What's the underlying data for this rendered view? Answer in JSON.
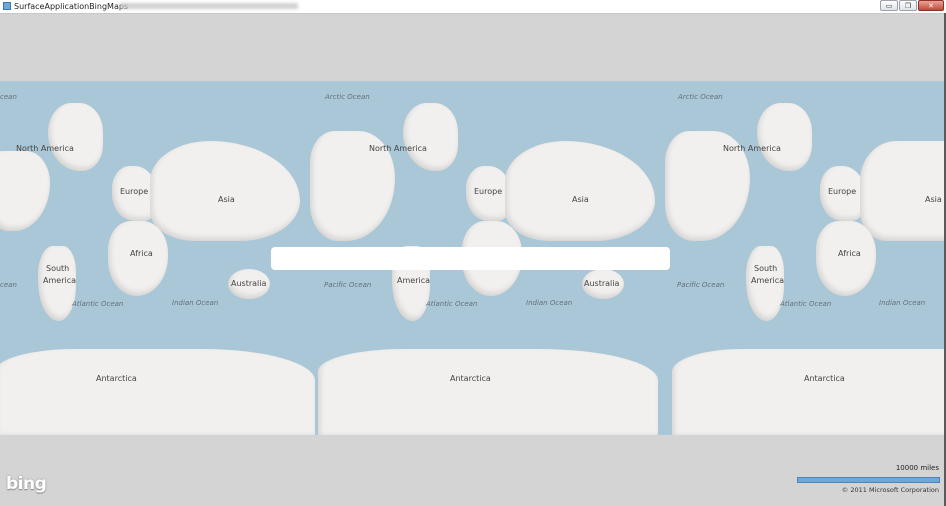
{
  "window": {
    "title": "SurfaceApplicationBingMaps",
    "controls": {
      "minimize": "▭",
      "maximize": "❐",
      "close": "✕"
    }
  },
  "map": {
    "continent_labels": [
      "North America",
      "Europe",
      "Asia",
      "Africa",
      "South America",
      "Australia",
      "Antarctica"
    ],
    "ocean_labels": [
      "Arctic Ocean",
      "Pacific Ocean",
      "Atlantic Ocean",
      "Indian Ocean"
    ],
    "edge_fragment": "cean",
    "labels_text": {
      "north_america": "North America",
      "europe": "Europe",
      "asia": "Asia",
      "africa": "Africa",
      "south": "South",
      "america": "America",
      "australia": "Australia",
      "antarctica": "Antarctica",
      "arctic_ocean": "Arctic Ocean",
      "pacific_ocean": "Pacific Ocean",
      "atlantic_ocean": "Atlantic Ocean",
      "indian_ocean": "Indian Ocean",
      "ocean_fragment": "cean"
    },
    "colors": {
      "water": "#aac7d7",
      "land": "#f1f0ee",
      "chrome": "#d4d4d4"
    }
  },
  "search": {
    "value": "",
    "placeholder": ""
  },
  "footer": {
    "logo": "bing",
    "scale_label": "10000 miles",
    "copyright": "© 2011 Microsoft Corporation"
  }
}
